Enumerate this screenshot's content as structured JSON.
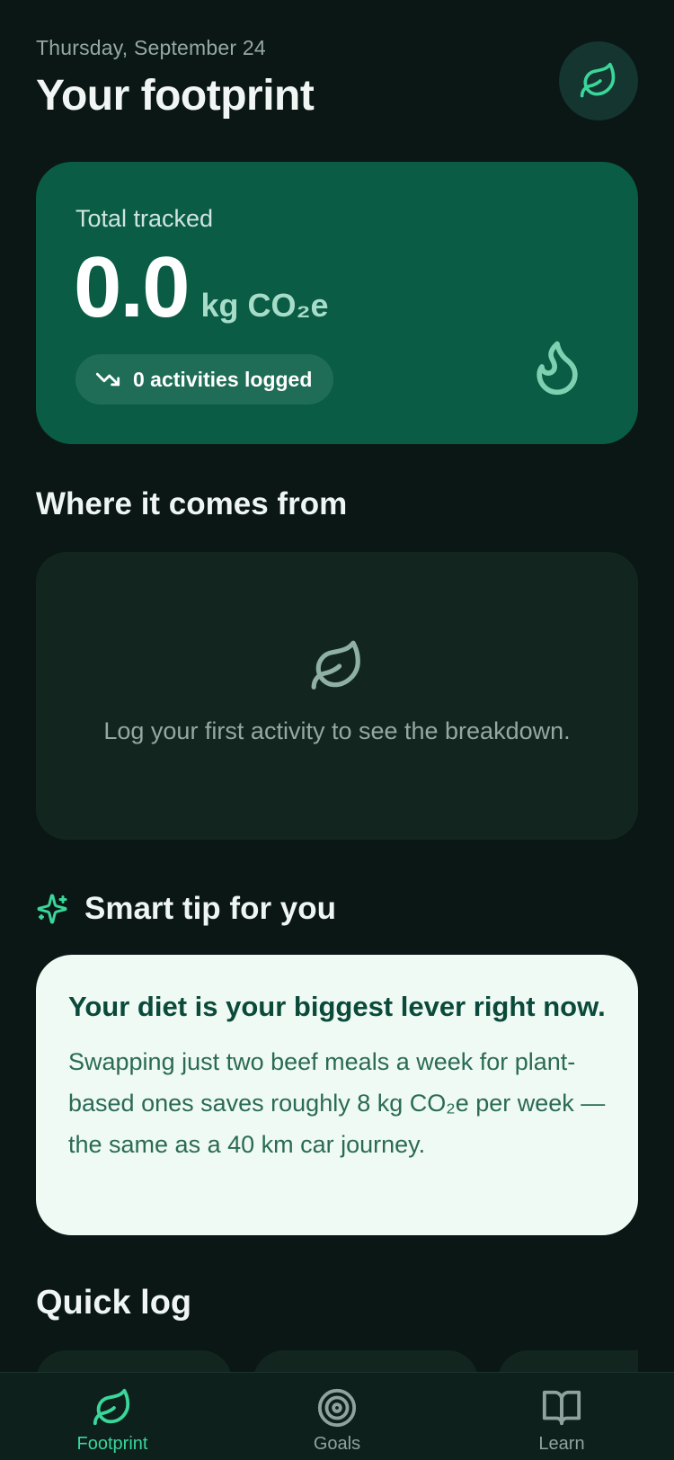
{
  "header": {
    "date": "Thursday, September 24",
    "title": "Your footprint"
  },
  "summary": {
    "label": "Total tracked",
    "value": "0.0",
    "unit": "kg CO₂e",
    "activities": "0 activities logged"
  },
  "breakdown": {
    "title": "Where it comes from",
    "empty_text": "Log your first activity to see the breakdown."
  },
  "tip": {
    "section_title": "Smart tip for you",
    "title": "Your diet is your biggest lever right now.",
    "body": "Swapping just two beef meals a week for plant-based ones saves roughly 8 kg CO₂e per week — the same as a 40 km car journey."
  },
  "quick_log": {
    "title": "Quick log"
  },
  "tabs": [
    {
      "label": "Footprint",
      "icon": "leaf-icon",
      "active": true
    },
    {
      "label": "Goals",
      "icon": "target-icon",
      "active": false
    },
    {
      "label": "Learn",
      "icon": "book-icon",
      "active": false
    }
  ],
  "colors": {
    "background": "#0a1715",
    "hero_card": "#0a5c45",
    "accent": "#3ad69a",
    "tip_card": "#eefaf3"
  }
}
